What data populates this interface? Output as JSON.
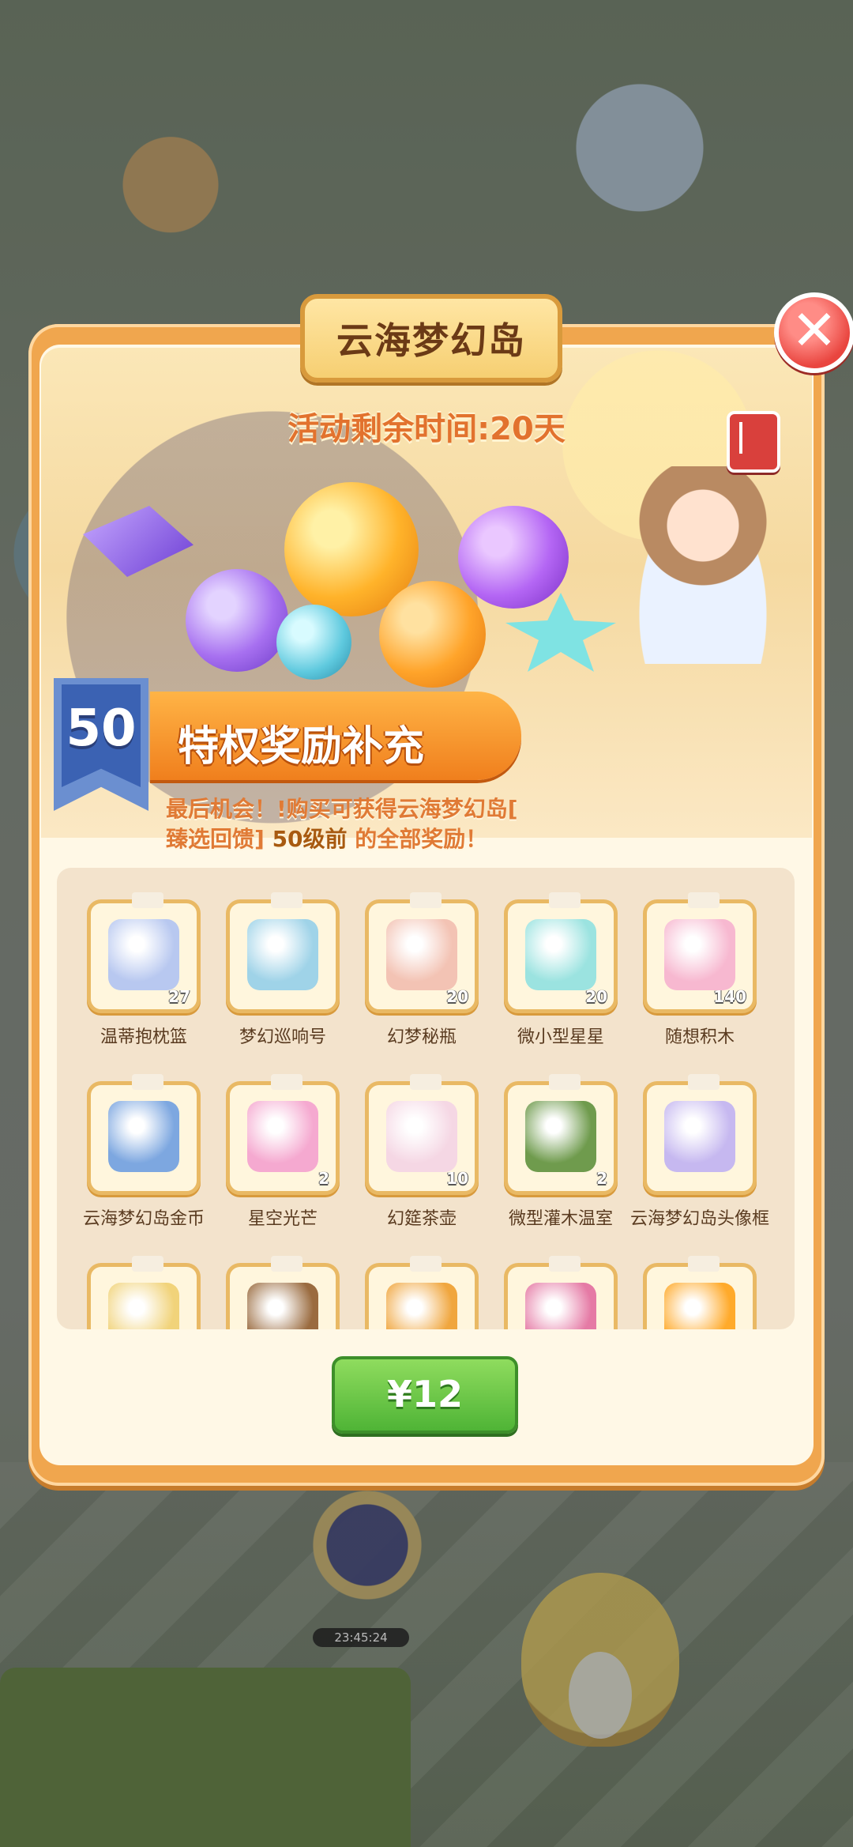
{
  "popup": {
    "title": "云海梦幻岛",
    "close_glyph": "✕",
    "remaining_time": "活动剩余时间:20天",
    "level": "50",
    "privilege_title": "特权奖励补充",
    "desc_line1": "最后机会！!购买可获得云海梦幻岛[",
    "desc_line2_a": "臻选回馈]",
    "desc_line2_hl": "50级前",
    "desc_line2_b": "的全部奖励！",
    "buy_label": "¥12"
  },
  "rewards": [
    {
      "name": "温蒂抱枕篮",
      "count": "27",
      "color": "#b8c8f0",
      "icon": "pillow-basket-icon"
    },
    {
      "name": "梦幻巡响号",
      "count": "",
      "color": "#9fd3e8",
      "icon": "ship-icon"
    },
    {
      "name": "幻梦秘瓶",
      "count": "20",
      "color": "#f3c3b4",
      "icon": "bottle-icon"
    },
    {
      "name": "微小型星星",
      "count": "20",
      "color": "#9be3e0",
      "icon": "star-icon"
    },
    {
      "name": "随想积木",
      "count": "140",
      "color": "#f7b8d0",
      "icon": "blocks-icon"
    },
    {
      "name": "云海梦幻岛金币",
      "count": "",
      "color": "#7da7e0",
      "icon": "coin-icon"
    },
    {
      "name": "星空光芒",
      "count": "2",
      "color": "#f5a9d0",
      "icon": "planet-icon"
    },
    {
      "name": "幻筵茶壶",
      "count": "10",
      "color": "#f5d7e4",
      "icon": "teapot-icon"
    },
    {
      "name": "微型灌木温室",
      "count": "2",
      "color": "#6f9b4d",
      "icon": "bush-icon"
    },
    {
      "name": "云海梦幻岛头像框",
      "count": "",
      "color": "#c6b8f0",
      "icon": "avatar-frame-icon"
    },
    {
      "name": "",
      "count": "",
      "color": "#f1d37a",
      "icon": "item-icon"
    },
    {
      "name": "",
      "count": "",
      "color": "#9a6b3f",
      "icon": "item-icon"
    },
    {
      "name": "",
      "count": "",
      "color": "#f0a63e",
      "icon": "item-icon"
    },
    {
      "name": "",
      "count": "",
      "color": "#e57aa5",
      "icon": "item-icon"
    },
    {
      "name": "",
      "count": "",
      "color": "#ffaa2b",
      "icon": "item-icon"
    }
  ],
  "background": {
    "timer": "23:45:24"
  }
}
